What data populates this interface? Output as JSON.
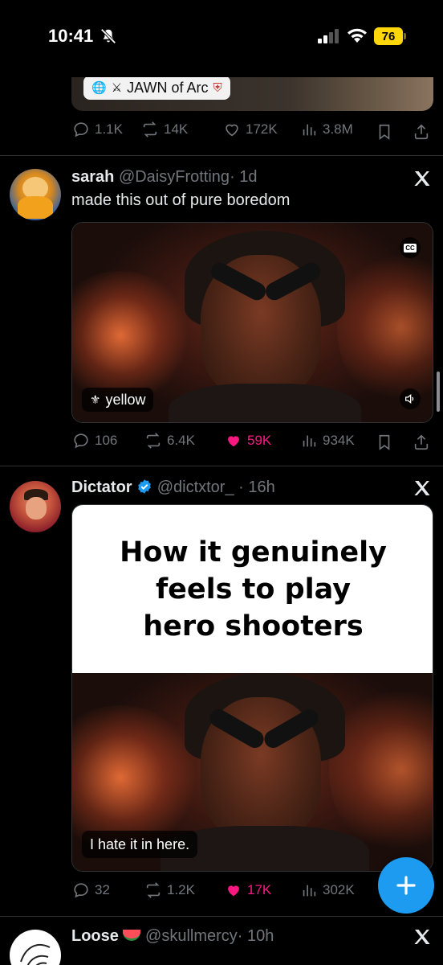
{
  "status_bar": {
    "time": "10:41",
    "battery": "76"
  },
  "tweet0": {
    "tag_label": "JAWN of Arc",
    "actions": {
      "replies": "1.1K",
      "reposts": "14K",
      "likes": "172K",
      "views": "3.8M"
    }
  },
  "tweet1": {
    "name": "sarah",
    "handle": "@DaisyFrotting",
    "time": "· 1d",
    "text": "made this out of pure boredom",
    "media_caption": "yellow",
    "cc_label": "CC",
    "actions": {
      "replies": "106",
      "reposts": "6.4K",
      "likes": "59K",
      "views": "934K"
    }
  },
  "tweet2": {
    "name": "Dictator",
    "handle": "@dictxtor_",
    "time": "· 16h",
    "meme_text_lines": [
      "How it genuinely",
      "feels to play",
      "hero shooters"
    ],
    "video_subtitle": "I hate it in here.",
    "actions": {
      "replies": "32",
      "reposts": "1.2K",
      "likes": "17K",
      "views": "302K"
    }
  },
  "tweet3": {
    "name": "Loose",
    "handle": "@skullmercy",
    "time": "· 10h"
  },
  "colors": {
    "accent": "#1d9bf0",
    "like": "#f91880",
    "muted": "#71767b",
    "battery": "#ffd60a"
  },
  "icons": [
    "reply-icon",
    "repost-icon",
    "like-icon",
    "views-icon",
    "bookmark-icon",
    "share-icon",
    "x-logo-icon",
    "verified-badge-icon",
    "compose-plus-icon"
  ]
}
